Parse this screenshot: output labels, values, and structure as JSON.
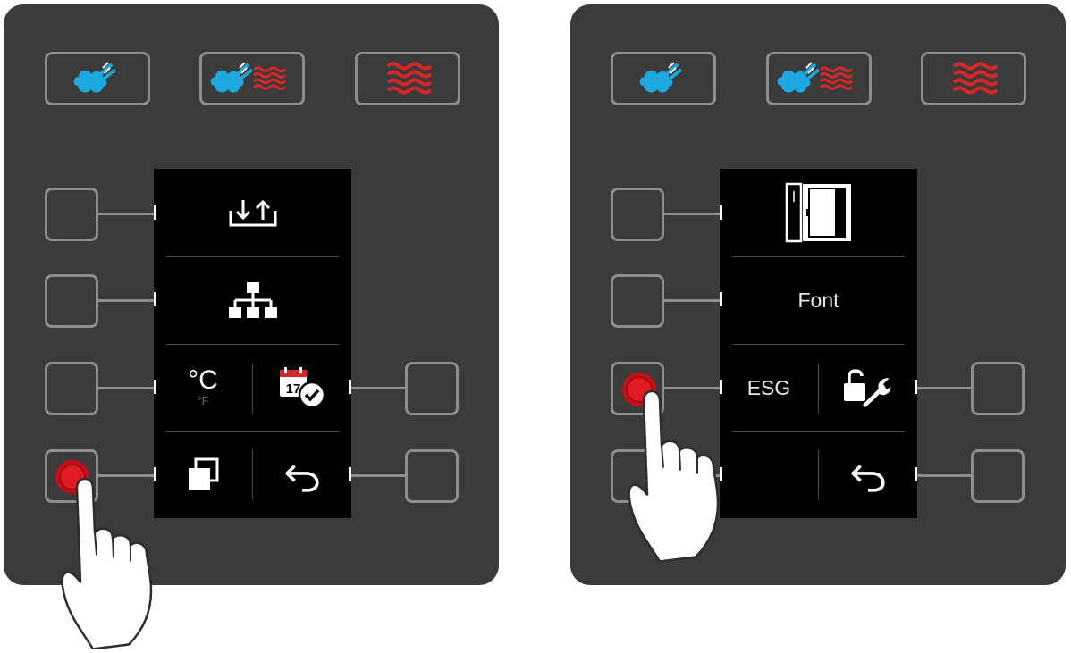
{
  "colors": {
    "panel": "#3b3b3b",
    "screen": "#000000",
    "steam": "#1ea8e0",
    "heat": "#d62828",
    "press": "#e01b24"
  },
  "left_panel": {
    "modes": [
      {
        "icon": "steam-icon"
      },
      {
        "icon": "combi-steam-heat-icon"
      },
      {
        "icon": "convection-heat-icon"
      }
    ],
    "screen": {
      "rows": [
        {
          "icon": "import-export-icon"
        },
        {
          "icon": "network-icon"
        },
        {
          "left_label": "°C",
          "left_sub": "°F",
          "right_icon": "calendar-check-icon"
        },
        {
          "left_icon": "copy-icon",
          "right_icon": "back-arrow-icon"
        }
      ]
    }
  },
  "right_panel": {
    "modes": [
      {
        "icon": "steam-icon"
      },
      {
        "icon": "combi-steam-heat-icon"
      },
      {
        "icon": "convection-heat-icon"
      }
    ],
    "screen": {
      "rows": [
        {
          "icon": "unit-door-icon"
        },
        {
          "label": "Font"
        },
        {
          "left_label": "ESG",
          "right_icon": "unlock-wrench-icon"
        },
        {
          "right_icon": "back-arrow-icon"
        }
      ]
    }
  }
}
